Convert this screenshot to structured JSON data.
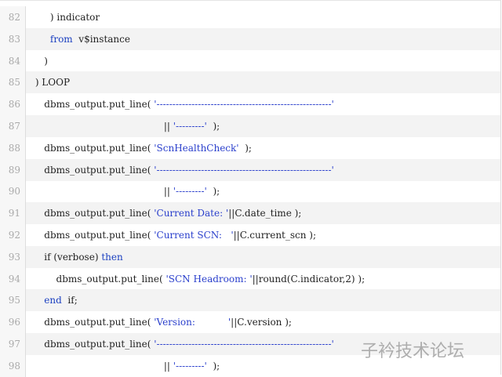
{
  "code_lines": [
    {
      "n": "82",
      "parts": [
        [
          "t",
          "      ) indicator"
        ]
      ]
    },
    {
      "n": "83",
      "parts": [
        [
          "t",
          "      "
        ],
        [
          "k",
          "from"
        ],
        [
          "t",
          "  v$instance"
        ]
      ]
    },
    {
      "n": "84",
      "parts": [
        [
          "t",
          "    )"
        ]
      ]
    },
    {
      "n": "85",
      "parts": [
        [
          "t",
          " ) LOOP"
        ]
      ]
    },
    {
      "n": "86",
      "parts": [
        [
          "t",
          "    dbms_output.put_line( "
        ],
        [
          "s",
          "'-------------------------------------------------------'"
        ]
      ]
    },
    {
      "n": "87",
      "parts": [
        [
          "t",
          "                                            || "
        ],
        [
          "s",
          "'---------'"
        ],
        [
          "t",
          "  );"
        ]
      ]
    },
    {
      "n": "88",
      "parts": [
        [
          "t",
          "    dbms_output.put_line( "
        ],
        [
          "s",
          "'ScnHealthCheck'"
        ],
        [
          "t",
          "  );"
        ]
      ]
    },
    {
      "n": "89",
      "parts": [
        [
          "t",
          "    dbms_output.put_line( "
        ],
        [
          "s",
          "'-------------------------------------------------------'"
        ]
      ]
    },
    {
      "n": "90",
      "parts": [
        [
          "t",
          "                                            || "
        ],
        [
          "s",
          "'---------'"
        ],
        [
          "t",
          "  );"
        ]
      ]
    },
    {
      "n": "91",
      "parts": [
        [
          "t",
          "    dbms_output.put_line( "
        ],
        [
          "s",
          "'Current Date: '"
        ],
        [
          "t",
          "||C.date_time );"
        ]
      ]
    },
    {
      "n": "92",
      "parts": [
        [
          "t",
          "    dbms_output.put_line( "
        ],
        [
          "s",
          "'Current SCN:   '"
        ],
        [
          "t",
          "||C.current_scn );"
        ]
      ]
    },
    {
      "n": "93",
      "parts": [
        [
          "t",
          "    if (verbose) "
        ],
        [
          "k",
          "then"
        ]
      ]
    },
    {
      "n": "94",
      "parts": [
        [
          "t",
          "        dbms_output.put_line( "
        ],
        [
          "s",
          "'SCN Headroom: '"
        ],
        [
          "t",
          "||round(C.indicator,2) );"
        ]
      ]
    },
    {
      "n": "95",
      "parts": [
        [
          "t",
          "    "
        ],
        [
          "k",
          "end"
        ],
        [
          "t",
          "  if;"
        ]
      ]
    },
    {
      "n": "96",
      "parts": [
        [
          "t",
          "    dbms_output.put_line( "
        ],
        [
          "s",
          "'Version:           '"
        ],
        [
          "t",
          "||C.version );"
        ]
      ]
    },
    {
      "n": "97",
      "parts": [
        [
          "t",
          "    dbms_output.put_line( "
        ],
        [
          "s",
          "'-------------------------------------------------------'"
        ]
      ]
    },
    {
      "n": "98",
      "parts": [
        [
          "t",
          "                                            || "
        ],
        [
          "s",
          "'---------'"
        ],
        [
          "t",
          "  );"
        ]
      ]
    }
  ],
  "watermark": "子衿技术论坛",
  "colors": {
    "keyword": "#1a3fc0",
    "string": "#2a3fcc",
    "text": "#222222"
  }
}
